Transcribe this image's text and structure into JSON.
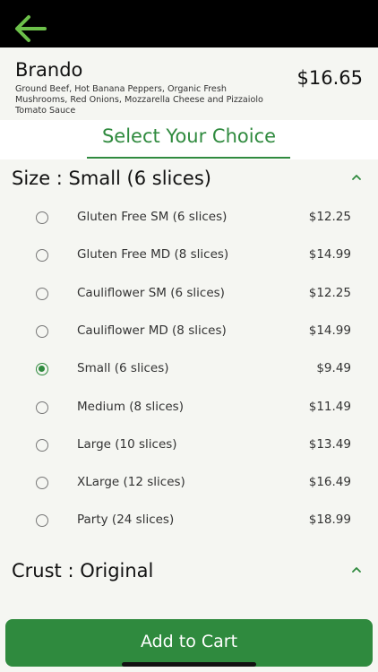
{
  "header": {
    "back_icon": "arrow-left-icon",
    "accent": "#6cc04a"
  },
  "product": {
    "name": "Brando",
    "description": "Ground Beef, Hot Banana Peppers, Organic Fresh Mushrooms, Red Onions, Mozzarella Cheese and Pizzaiolo Tomato Sauce",
    "price": "$16.65"
  },
  "choice": {
    "title": "Select Your Choice",
    "color": "#2f8a3e"
  },
  "size_section": {
    "title": "Size : Small (6 slices)",
    "caret_icon": "chevron-up-icon",
    "options": [
      {
        "label": "Gluten Free SM (6 slices)",
        "price": "$12.25",
        "selected": false
      },
      {
        "label": "Gluten Free MD (8 slices)",
        "price": "$14.99",
        "selected": false
      },
      {
        "label": "Cauliflower SM (6 slices)",
        "price": "$12.25",
        "selected": false
      },
      {
        "label": "Cauliflower MD (8 slices)",
        "price": "$14.99",
        "selected": false
      },
      {
        "label": "Small (6 slices)",
        "price": "$9.49",
        "selected": true
      },
      {
        "label": "Medium (8 slices)",
        "price": "$11.49",
        "selected": false
      },
      {
        "label": "Large (10 slices)",
        "price": "$13.49",
        "selected": false
      },
      {
        "label": "XLarge (12 slices)",
        "price": "$16.49",
        "selected": false
      },
      {
        "label": "Party (24 slices)",
        "price": "$18.99",
        "selected": false
      }
    ]
  },
  "crust_section": {
    "title": "Crust : Original",
    "caret_icon": "chevron-up-icon"
  },
  "cart": {
    "label": "Add to Cart"
  }
}
